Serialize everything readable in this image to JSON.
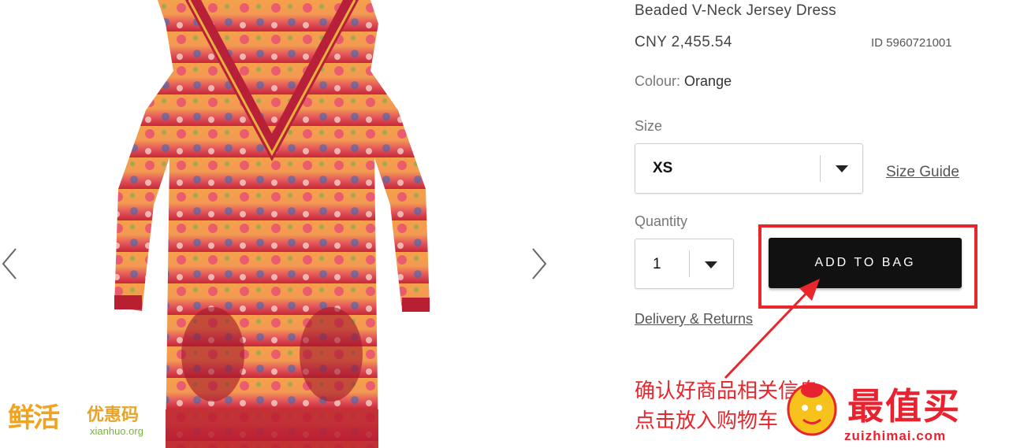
{
  "product": {
    "title": "Beaded V-Neck Jersey Dress",
    "price": "CNY 2,455.54",
    "id_label": "ID 5960721001",
    "colour_label": "Colour:",
    "colour_value": "Orange"
  },
  "size": {
    "label": "Size",
    "selected": "XS",
    "guide_link": "Size Guide"
  },
  "quantity": {
    "label": "Quantity",
    "selected": "1"
  },
  "actions": {
    "add_to_bag": "ADD TO BAG",
    "delivery_link": "Delivery & Returns"
  },
  "annotation": {
    "line1": "确认好商品相关信息",
    "line2": "点击放入购物车"
  },
  "watermarks": {
    "left_big": "鲜活",
    "left_small": "优惠码",
    "left_site": "xianhuo.org",
    "right_cn": "最值买",
    "right_site": "zuizhimai.com"
  },
  "colors": {
    "accent_red": "#e8262c",
    "button_black": "#111111"
  },
  "icons": {
    "prev": "chevron-left-icon",
    "next": "chevron-right-icon",
    "dropdown": "caret-down-icon"
  }
}
